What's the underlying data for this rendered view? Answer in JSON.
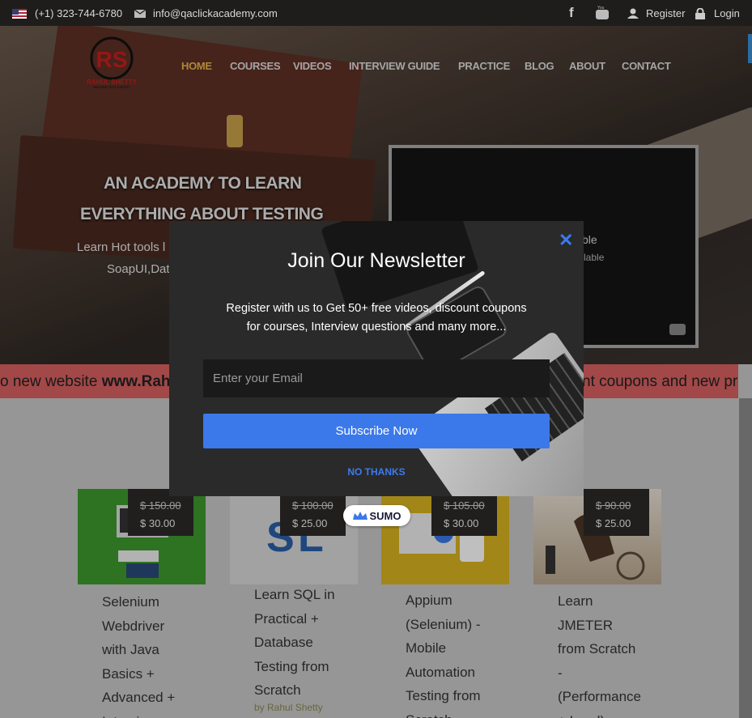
{
  "topbar": {
    "phone": "(+1) 323-744-6780",
    "email": "info@qaclickacademy.com",
    "register": "Register",
    "login": "Login"
  },
  "nav": {
    "items": [
      "HOME",
      "COURSES",
      "VIDEOS",
      "INTERVIEW GUIDE",
      "PRACTICE",
      "BLOG",
      "ABOUT",
      "CONTACT"
    ],
    "active": "HOME"
  },
  "logo": {
    "initials": "RS",
    "name": "RAHUL SHETTY",
    "tagline": "BECOME TEST EXPERT"
  },
  "hero": {
    "title_line1": "AN ACADEMY TO LEARN",
    "title_line2": "EVERYTHING ABOUT TESTING",
    "sub_line1": "Learn Hot tools l",
    "sub_line2": "SoapUI,Dat"
  },
  "video": {
    "status1": "ble",
    "status2": "available"
  },
  "banner": {
    "left_text": "o new website ",
    "left_bold": "www.Rah",
    "right_text": "nt coupons and new pr"
  },
  "courses": [
    {
      "old_price": "$ 150.00",
      "price": "$ 30.00",
      "title_lines": [
        "Selenium",
        "Webdriver",
        "with Java",
        "Basics +",
        "Advanced +",
        "Interview"
      ]
    },
    {
      "old_price": "$ 100.00",
      "price": "$ 25.00",
      "title_lines": [
        "Learn SQL in",
        "Practical +",
        "Database",
        "Testing from",
        "Scratch"
      ],
      "author": "by Rahul Shetty"
    },
    {
      "old_price": "$ 105.00",
      "price": "$ 30.00",
      "title_lines": [
        "Appium",
        "(Selenium) -",
        "Mobile",
        "Automation",
        "Testing from",
        "Scratch"
      ]
    },
    {
      "old_price": "$ 90.00",
      "price": "$ 25.00",
      "title_lines": [
        "Learn",
        "JMETER",
        "from Scratch",
        "-",
        "(Performance",
        "+ Load)"
      ]
    }
  ],
  "modal": {
    "title": "Join Our Newsletter",
    "text": "Register with us to Get 50+ free videos, discount coupons for courses, Interview questions and many more...",
    "email_placeholder": "Enter your Email",
    "subscribe": "Subscribe Now",
    "no_thanks": "NO THANKS",
    "close": "✕"
  },
  "sumo": {
    "label": "SUMO"
  },
  "colors": {
    "accent": "#3b78ea",
    "nav_active": "#e8b64a",
    "banner": "#d86161"
  }
}
